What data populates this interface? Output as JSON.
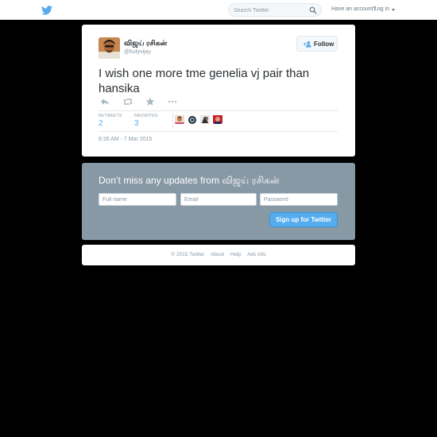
{
  "topbar": {
    "search_placeholder": "Search Twitter",
    "account_prompt": "Have an account?",
    "login_label": "Log in"
  },
  "tweet": {
    "author_name": "விஜய் ரசிகன்",
    "author_handle": "@kutyvijay",
    "follow_label": "Follow",
    "text": "I wish one more tme genelia vj pair than hansika",
    "retweets_label": "RETWEETS",
    "retweets_count": "2",
    "favorites_label": "FAVORITES",
    "favorites_count": "3",
    "timestamp": "8:26 AM - 7 Mar 2015",
    "actions": [
      "reply-icon",
      "retweet-icon",
      "favorite-icon",
      "more-icon"
    ]
  },
  "signup": {
    "title": "Don’t miss any updates from விஜய் ரசிகன்",
    "fullname_placeholder": "Full name",
    "email_placeholder": "Email",
    "password_placeholder": "Password",
    "button_label": "Sign up for Twitter"
  },
  "footer": {
    "copyright": "© 2015 Twitter",
    "links": [
      "About",
      "Help",
      "Ads info"
    ]
  },
  "colors": {
    "accent": "#55acee",
    "signup_bg": "#8899a6",
    "page_bg": "#000000"
  }
}
